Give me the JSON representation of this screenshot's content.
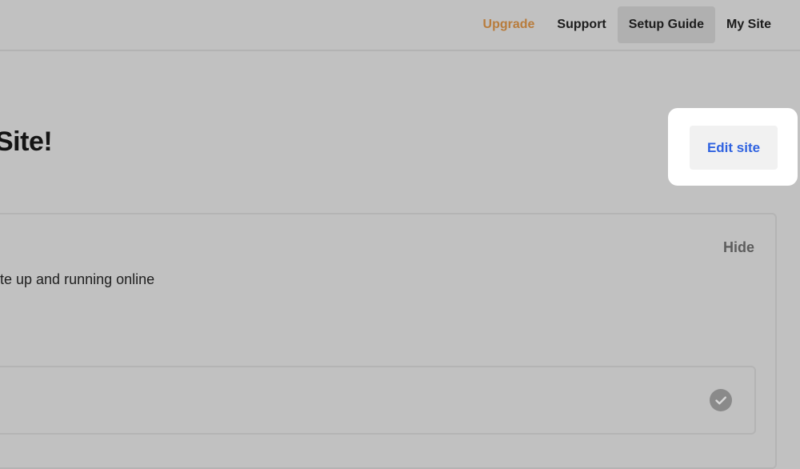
{
  "nav": {
    "upgrade": "Upgrade",
    "support": "Support",
    "setup_guide": "Setup Guide",
    "my_site": "My Site"
  },
  "page": {
    "title": "Site!"
  },
  "edit": {
    "label": "Edit site"
  },
  "guide": {
    "hide_label": "Hide",
    "description": "te up and running online"
  },
  "task": {
    "status_icon": "check-circle-icon"
  },
  "colors": {
    "background": "#c1c1c1",
    "upgrade_accent": "#b87c3c",
    "edit_link": "#2f62e0",
    "highlight": "#ffffff"
  }
}
